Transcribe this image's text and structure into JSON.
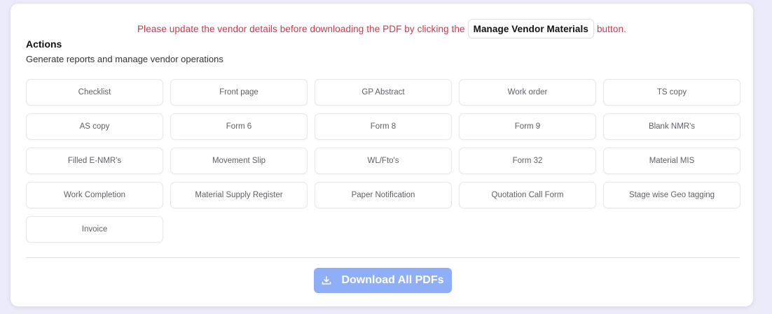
{
  "notice": {
    "prefix": "Please update the vendor details before downloading the PDF by clicking the",
    "button_label": "Manage Vendor Materials",
    "suffix": "button.",
    "color": "#d1364b"
  },
  "section": {
    "title": "Actions",
    "subtitle": "Generate reports and manage vendor operations"
  },
  "actions": [
    "Checklist",
    "Front page",
    "GP Abstract",
    "Work order",
    "TS copy",
    "AS copy",
    "Form 6",
    "Form 8",
    "Form 9",
    "Blank NMR's",
    "Filled E-NMR's",
    "Movement Slip",
    "WL/Fto's",
    "Form 32",
    "Material MIS",
    "Work Completion",
    "Material Supply Register",
    "Paper Notification",
    "Quotation Call Form",
    "Stage wise Geo tagging",
    "Invoice"
  ],
  "download": {
    "label": "Download All PDFs",
    "icon": "download-icon",
    "color": "#8eaff8"
  }
}
